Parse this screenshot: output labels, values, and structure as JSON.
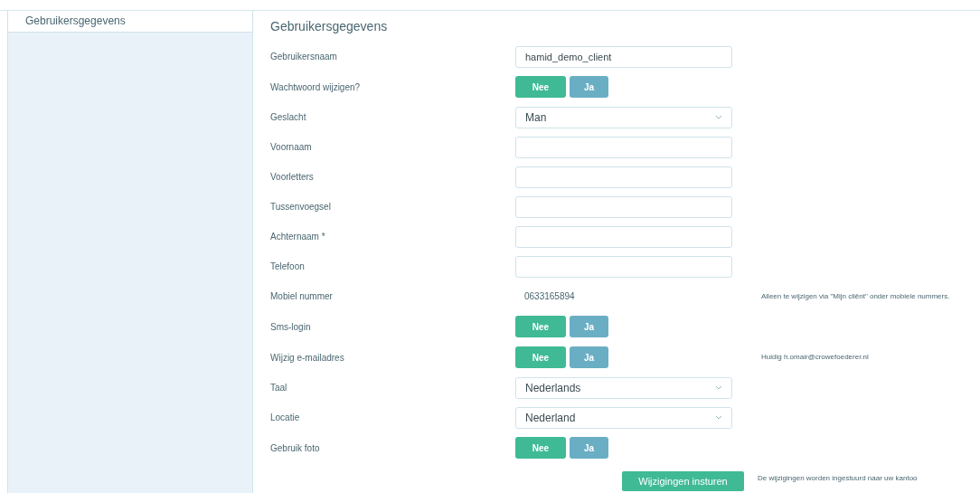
{
  "sidebar": {
    "items": [
      {
        "label": "Gebruikersgegevens",
        "selected": true
      }
    ]
  },
  "form": {
    "title": "Gebruikersgegevens",
    "rows": [
      {
        "label": "Gebruikersnaam",
        "kind": "text",
        "value": "hamid_demo_client"
      },
      {
        "label": "Wachtwoord wijzigen?",
        "kind": "toggle",
        "options": [
          {
            "label": "Nee",
            "selected": true
          },
          {
            "label": "Ja",
            "selected": false
          }
        ]
      },
      {
        "label": "Geslacht",
        "kind": "select",
        "value": "Man"
      },
      {
        "label": "Voornaam",
        "kind": "text"
      },
      {
        "label": "Voorletters",
        "kind": "text"
      },
      {
        "label": "Tussenvoegsel",
        "kind": "text"
      },
      {
        "label": "Achternaam *",
        "kind": "text"
      },
      {
        "label": "Telefoon",
        "kind": "text"
      },
      {
        "label": "Mobiel nummer",
        "kind": "static",
        "value": "0633165894",
        "note": "Alleen te wijzigen via \"Mijn cliënt\" onder mobiele nummers."
      },
      {
        "label": "Sms-login",
        "kind": "toggle",
        "options": [
          {
            "label": "Nee",
            "selected": true
          },
          {
            "label": "Ja",
            "selected": false
          }
        ]
      },
      {
        "label": "Wijzig e-mailadres",
        "kind": "toggle",
        "options": [
          {
            "label": "Nee",
            "selected": true
          },
          {
            "label": "Ja",
            "selected": false
          }
        ],
        "note": "Huidig h.omair@crowefoederer.nl"
      },
      {
        "label": "Taal",
        "kind": "select",
        "value": "Nederlands"
      },
      {
        "label": "Locatie",
        "kind": "select",
        "value": "Nederland"
      },
      {
        "label": "Gebruik foto",
        "kind": "toggle",
        "options": [
          {
            "label": "Nee",
            "selected": true
          },
          {
            "label": "Ja",
            "selected": false
          }
        ]
      }
    ],
    "submit": {
      "label": "Wijzigingen insturen",
      "note": "De wijzigingen worden ingestuurd naar uw kantoo"
    }
  }
}
